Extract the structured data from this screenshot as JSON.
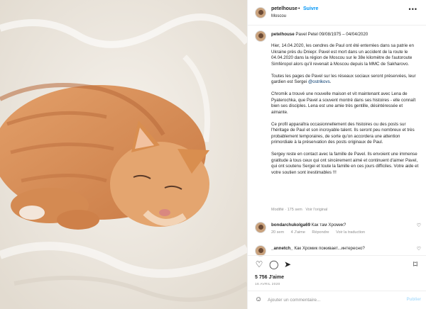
{
  "photo": {
    "alt_subject": "orange-cat-sleeping-on-fur",
    "colors": {
      "fur": "#f1ece4",
      "cat": "#d98e4f",
      "cat_dark": "#b8693a"
    }
  },
  "header": {
    "username": "petelhouse",
    "separator": "•",
    "follow_label": "Suivre",
    "location": "Moscou",
    "more_icon": "more-horizontal-icon"
  },
  "caption": {
    "username": "petelhouse",
    "title": "Pavel Petel 09/08/1975 – 04/04/2020",
    "paragraphs": [
      "Hier, 14.04.2020, les cendres de Paul ont été enterrées dans sa patrie en Ukraine près du Dniepr. Pavel est mort dans un accident de la route le 04.04.2020 dans la région de Moscou sur le 38e kilomètre de l'autoroute Simféropol alors qu'il revenait à Moscou depuis la MMC de Sakharovo.",
      "Toutes les pages de Pavel sur les réseaux sociaux seront préservées, leur gardien est Sergei",
      "Chromik a trouvé une nouvelle maison et vit maintenant avec Lena de Pyaterochka, que Pavel a souvent montré dans ses histoires - elle connaît bien ses disciples. Lena est une amie très gentille, désintéressée et aimante.",
      "Ce profil apparaîtra occasionnellement des histoires ou des posts sur l'héritage de Paul et son incroyable talent. Ils seront peu nombreux et très probablement temporaires, de sorte qu'on accordera une attention primordiale à la préservation des posts originaux de Paul.",
      "Sergey reste en contact avec la famille de Pavel. Ils envoient une immense gratitude à tous ceux qui ont sincèrement aimé et continuent d'aimer Pavel, qui ont soutenu Sergei et toute la famille en ces jours difficiles. Votre aide et votre soutien sont inestimables !!!"
    ],
    "mention": "@ostrikovs",
    "mention_suffix": ".",
    "meta_modified": "Modifié · 175 sem",
    "meta_original": "Voir l'original"
  },
  "comments": [
    {
      "username": "bondarchukolga69",
      "text": "Как там Хромик?",
      "age": "20 sem",
      "likes": "4 J'aime",
      "reply": "Répondre",
      "translate": "Voir la traduction"
    },
    {
      "username": "_annetch_",
      "text": "Как Хромик поживает...интересно?",
      "age": "",
      "likes": "",
      "reply": "",
      "translate": ""
    }
  ],
  "actions": {
    "like_icon": "heart-icon",
    "comment_icon": "comment-icon",
    "share_icon": "send-icon",
    "save_icon": "bookmark-icon"
  },
  "likes": "5 756 J'aime",
  "date": "16 AVRIL 2020",
  "add_comment": {
    "placeholder": "Ajouter un commentaire...",
    "publish_label": "Publier",
    "emoji_icon": "emoji-icon"
  }
}
